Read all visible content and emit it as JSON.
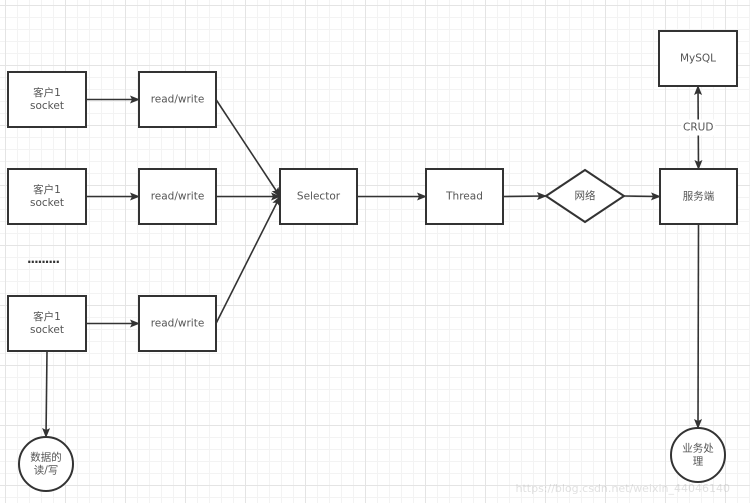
{
  "diagram": {
    "nodes": [
      {
        "id": "client1",
        "shape": "rect",
        "lines": [
          "客户1",
          "socket"
        ]
      },
      {
        "id": "client2",
        "shape": "rect",
        "lines": [
          "客户1",
          "socket"
        ]
      },
      {
        "id": "client3",
        "shape": "rect",
        "lines": [
          "客户1",
          "socket"
        ]
      },
      {
        "id": "rw1",
        "shape": "rect",
        "lines": [
          "read/write"
        ]
      },
      {
        "id": "rw2",
        "shape": "rect",
        "lines": [
          "read/write"
        ]
      },
      {
        "id": "rw3",
        "shape": "rect",
        "lines": [
          "read/write"
        ]
      },
      {
        "id": "selector",
        "shape": "rect",
        "lines": [
          "Selector"
        ]
      },
      {
        "id": "thread",
        "shape": "rect",
        "lines": [
          "Thread"
        ]
      },
      {
        "id": "network",
        "shape": "diamond",
        "lines": [
          "网络"
        ]
      },
      {
        "id": "server",
        "shape": "rect",
        "lines": [
          "服务端"
        ]
      },
      {
        "id": "mysql",
        "shape": "rect",
        "lines": [
          "MySQL"
        ]
      },
      {
        "id": "data_rw",
        "shape": "circle",
        "lines": [
          "数据的",
          "读/写"
        ]
      },
      {
        "id": "business",
        "shape": "circle",
        "lines": [
          "业务处",
          "理"
        ]
      }
    ],
    "edges": [
      {
        "from": "client1",
        "to": "rw1",
        "label": ""
      },
      {
        "from": "client2",
        "to": "rw2",
        "label": ""
      },
      {
        "from": "client3",
        "to": "rw3",
        "label": ""
      },
      {
        "from": "rw1",
        "to": "selector",
        "label": ""
      },
      {
        "from": "rw2",
        "to": "selector",
        "label": ""
      },
      {
        "from": "rw3",
        "to": "selector",
        "label": ""
      },
      {
        "from": "selector",
        "to": "thread",
        "label": ""
      },
      {
        "from": "thread",
        "to": "network",
        "label": ""
      },
      {
        "from": "network",
        "to": "server",
        "label": ""
      },
      {
        "from": "server",
        "to": "mysql",
        "label": "CRUD",
        "bidirectional": true
      },
      {
        "from": "server",
        "to": "business",
        "label": ""
      },
      {
        "from": "client3",
        "to": "data_rw",
        "label": ""
      }
    ],
    "ellipsis": "·········",
    "watermark": "https://blog.csdn.net/weixin_44046140"
  }
}
